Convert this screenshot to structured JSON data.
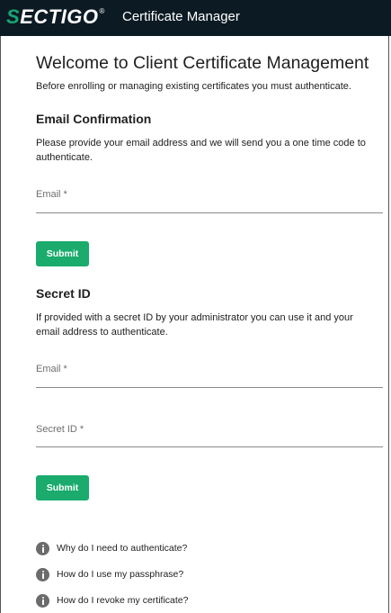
{
  "header": {
    "logo_s": "S",
    "logo_rest": "ECTIGO",
    "logo_reg": "®",
    "app_title": "Certificate Manager",
    "background_color": "#0c1a24",
    "logo_accent_color": "#17a673"
  },
  "welcome": {
    "title": "Welcome to Client Certificate Management",
    "subtitle": "Before enrolling or managing existing certificates you must authenticate."
  },
  "email_confirmation": {
    "title": "Email Confirmation",
    "description": "Please provide your email address and we will send you a one time code to authenticate.",
    "email_label": "Email *",
    "email_value": "",
    "submit_label": "Submit"
  },
  "secret_id": {
    "title": "Secret ID",
    "description": "If provided with a secret ID by your administrator you can use it and your email address to authenticate.",
    "email_label": "Email *",
    "email_value": "",
    "secret_label": "Secret ID *",
    "secret_value": "",
    "submit_label": "Submit"
  },
  "faq": {
    "icon": "info-icon",
    "items": [
      {
        "label": "Why do I need to authenticate?"
      },
      {
        "label": "How do I use my passphrase?"
      },
      {
        "label": "How do I revoke my certificate?"
      }
    ]
  },
  "colors": {
    "button": "#1aab6d",
    "text": "#212121",
    "field_label": "#6e6e6e"
  }
}
